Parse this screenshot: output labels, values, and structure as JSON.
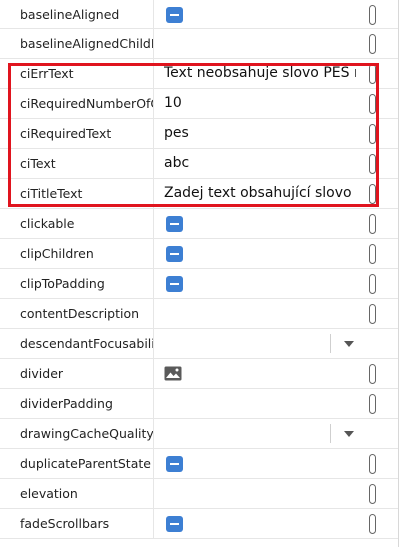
{
  "properties": [
    {
      "name": "baselineAligned",
      "kind": "bool"
    },
    {
      "name": "baselineAlignedChildIndex",
      "kind": "text",
      "value": ""
    },
    {
      "name": "ciErrText",
      "kind": "text",
      "value": "Text neobsahuje slovo PES ne"
    },
    {
      "name": "ciRequiredNumberOfOccurrences",
      "kind": "text",
      "value": "10"
    },
    {
      "name": "ciRequiredText",
      "kind": "text",
      "value": "pes"
    },
    {
      "name": "ciText",
      "kind": "text",
      "value": "abc"
    },
    {
      "name": "ciTitleText",
      "kind": "text",
      "value": "Zadej text obsahující slovo PES"
    },
    {
      "name": "clickable",
      "kind": "bool"
    },
    {
      "name": "clipChildren",
      "kind": "bool"
    },
    {
      "name": "clipToPadding",
      "kind": "bool"
    },
    {
      "name": "contentDescription",
      "kind": "text",
      "value": ""
    },
    {
      "name": "descendantFocusability",
      "kind": "dropdown",
      "value": ""
    },
    {
      "name": "divider",
      "kind": "image"
    },
    {
      "name": "dividerPadding",
      "kind": "text",
      "value": ""
    },
    {
      "name": "drawingCacheQuality",
      "kind": "dropdown",
      "value": ""
    },
    {
      "name": "duplicateParentState",
      "kind": "bool"
    },
    {
      "name": "elevation",
      "kind": "text",
      "value": ""
    },
    {
      "name": "fadeScrollbars",
      "kind": "bool"
    }
  ],
  "colors": {
    "bool_icon": "#3d7fd3",
    "highlight": "#e0141e"
  },
  "icons": {
    "bool": "checkbox-indeterminate-icon",
    "image": "image-icon",
    "dropdown": "chevron-down-icon",
    "resource_picker": "resource-picker-icon"
  }
}
